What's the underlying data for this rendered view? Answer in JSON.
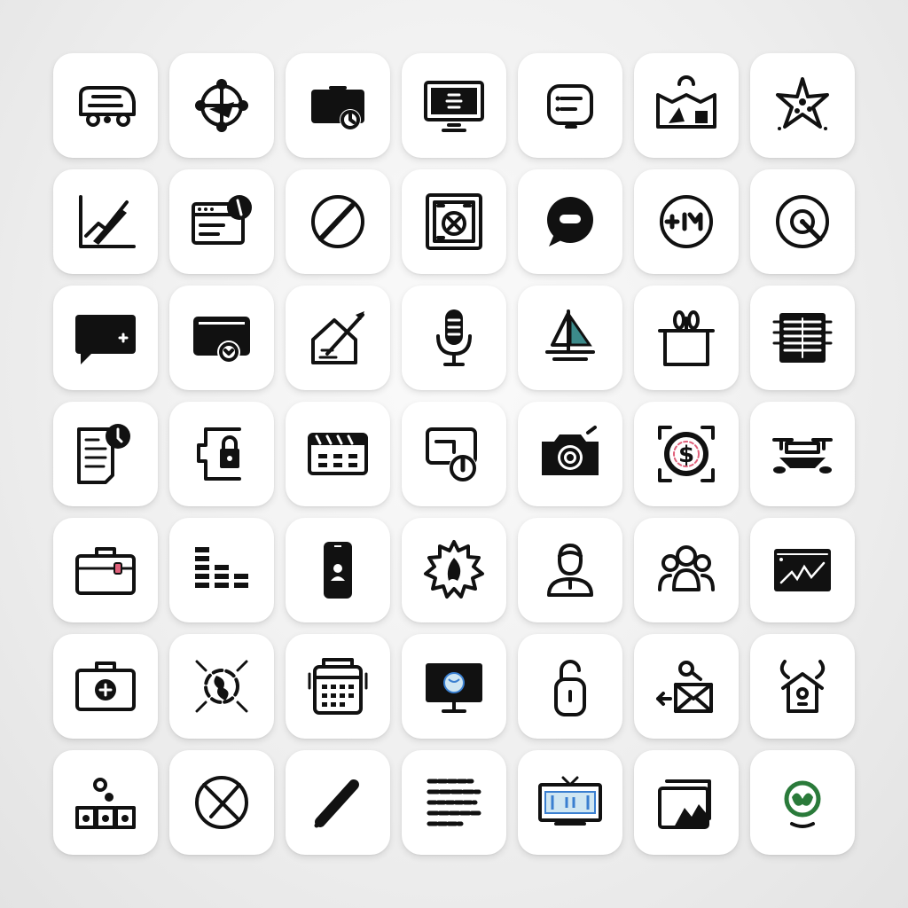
{
  "colors": {
    "background": "#eeeeee",
    "tile": "#ffffff",
    "icon": "#111111",
    "accent_pink": "#e0607a",
    "accent_teal": "#3c8a8a",
    "accent_green": "#2a7a3a",
    "accent_blue": "#3a7fd0"
  },
  "icons": [
    "van-icon",
    "compass-icon",
    "camera-bag-icon",
    "monitor-icon",
    "chat-list-icon",
    "map-icon",
    "starfish-icon",
    "chart-pencil-icon",
    "browser-window-icon",
    "no-pen-icon",
    "puzzle-frame-icon",
    "speech-bubble-icon",
    "plus-minus-icon",
    "vinyl-record-icon",
    "message-box-icon",
    "photo-sync-icon",
    "house-arrow-icon",
    "microphone-icon",
    "sailboat-icon",
    "plant-box-icon",
    "server-rack-icon",
    "document-clock-icon",
    "puzzle-lock-icon",
    "film-calendar-icon",
    "screen-timer-icon",
    "camera-icon",
    "dollar-target-icon",
    "drone-icon",
    "briefcase-icon",
    "bar-stack-icon",
    "smartphone-icon",
    "gear-flame-icon",
    "user-avatar-icon",
    "user-group-icon",
    "terminal-graph-icon",
    "first-aid-kit-icon",
    "globe-arrows-icon",
    "printer-calendar-icon",
    "desktop-globe-icon",
    "padlock-icon",
    "mail-export-icon",
    "viking-house-icon",
    "block-people-icon",
    "circle-x-icon",
    "pencil-icon",
    "text-lines-icon",
    "tv-screen-icon",
    "landscape-photo-icon",
    "leaf-globe-icon"
  ]
}
